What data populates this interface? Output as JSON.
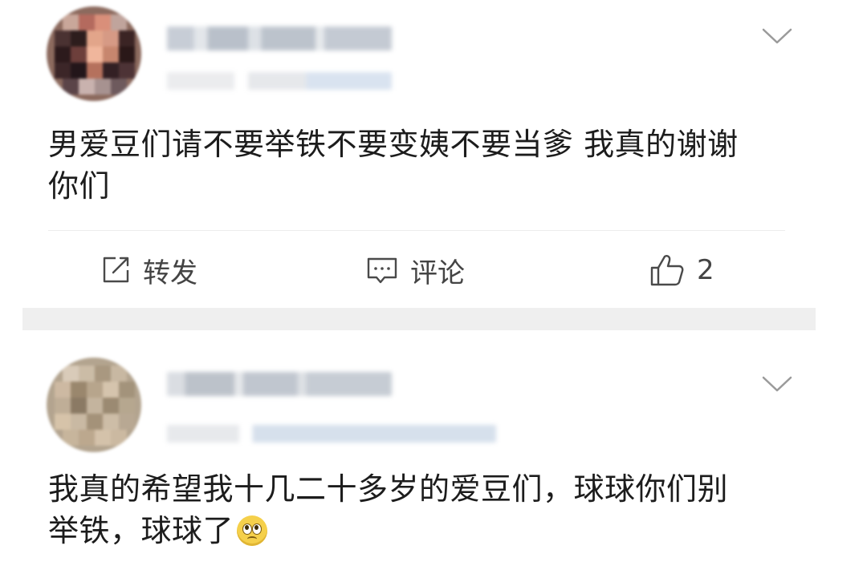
{
  "posts": [
    {
      "text_lines": [
        "男爱豆们请不要举铁不要变姨不要当爹 我真的谢谢",
        "你们"
      ],
      "actions": {
        "repost_label": "转发",
        "comment_label": "评论",
        "like_count": "2"
      },
      "icons": {
        "repost": "repost-icon",
        "comment": "comment-icon",
        "like": "thumbs-up-icon",
        "menu": "chevron-down-icon"
      }
    },
    {
      "text_lines": [
        "我真的希望我十几二十多岁的爱豆们，球球你们别",
        "举铁，球球了"
      ],
      "emoji": "pleading-face-emoji",
      "icons": {
        "menu": "chevron-down-icon"
      }
    }
  ],
  "colors": {
    "separator": "#efefef",
    "text": "#1c1c1c",
    "action": "#444444",
    "emoji": "#f5d04b"
  }
}
